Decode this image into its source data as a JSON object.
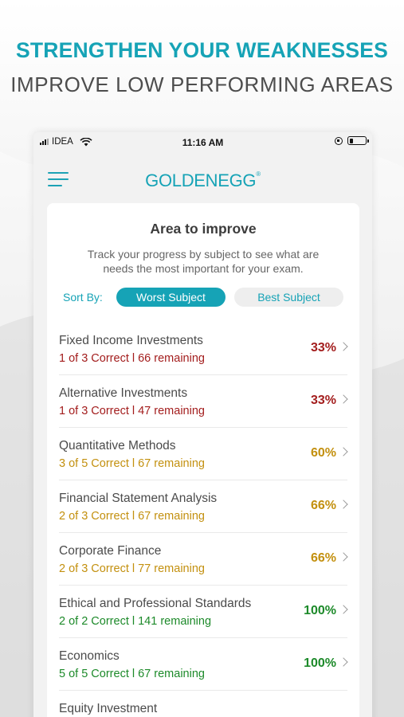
{
  "promo": {
    "title": "STRENGTHEN YOUR WEAKNESSES",
    "subtitle": "IMPROVE LOW PERFORMING AREAS"
  },
  "status_bar": {
    "carrier": "IDEA",
    "time": "11:16 AM",
    "battery_level": 0.25
  },
  "header": {
    "logo": "GOLDENEGG",
    "trademark": "®"
  },
  "card": {
    "title": "Area to improve",
    "description": "Track your progress by subject to see what are needs the most important for your exam."
  },
  "sort": {
    "label": "Sort By:",
    "options": [
      "Worst Subject",
      "Best Subject"
    ],
    "selected": "Worst Subject"
  },
  "colors": {
    "accent": "#16a3b6",
    "low": "#a31d1d",
    "mid": "#c3900f",
    "high": "#1d8a2a"
  },
  "subjects": [
    {
      "name": "Fixed Income Investments",
      "stats": "1 of 3  Correct l 66 remaining",
      "percent": "33%",
      "level": "low"
    },
    {
      "name": "Alternative Investments",
      "stats": "1 of 3  Correct l 47 remaining",
      "percent": "33%",
      "level": "low"
    },
    {
      "name": "Quantitative Methods",
      "stats": "3 of 5  Correct l 67 remaining",
      "percent": "60%",
      "level": "mid"
    },
    {
      "name": "Financial Statement Analysis",
      "stats": "2 of 3  Correct l 67 remaining",
      "percent": "66%",
      "level": "mid"
    },
    {
      "name": "Corporate Finance",
      "stats": "2 of 3  Correct l 77 remaining",
      "percent": "66%",
      "level": "mid"
    },
    {
      "name": "Ethical and Professional Standards",
      "stats": "2 of 2  Correct l 141 remaining",
      "percent": "100%",
      "level": "high"
    },
    {
      "name": "Economics",
      "stats": "5 of 5  Correct l 67 remaining",
      "percent": "100%",
      "level": "high"
    },
    {
      "name": "Equity Investment",
      "stats": "",
      "percent": "",
      "level": "partial"
    }
  ]
}
